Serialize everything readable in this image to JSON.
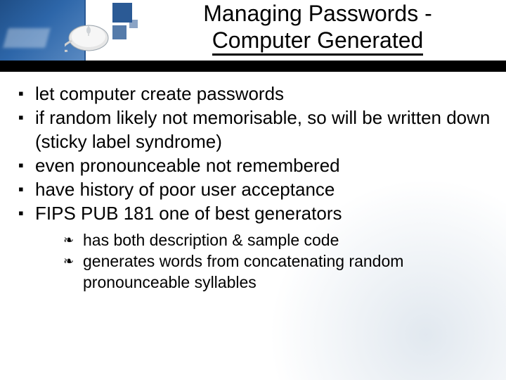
{
  "title": {
    "line1": "Managing Passwords -",
    "line2": "Computer Generated"
  },
  "bullets": [
    {
      "text": "let computer create passwords"
    },
    {
      "text": "if random likely not memorisable, so will be written down (sticky label syndrome)"
    },
    {
      "text": "even pronounceable not remembered"
    },
    {
      "text": "have history of poor user acceptance"
    },
    {
      "text": "FIPS PUB 181 one of best generators",
      "sub": [
        {
          "text": "has both description & sample code"
        },
        {
          "text": "generates words from concatenating random pronounceable syllables"
        }
      ]
    }
  ]
}
